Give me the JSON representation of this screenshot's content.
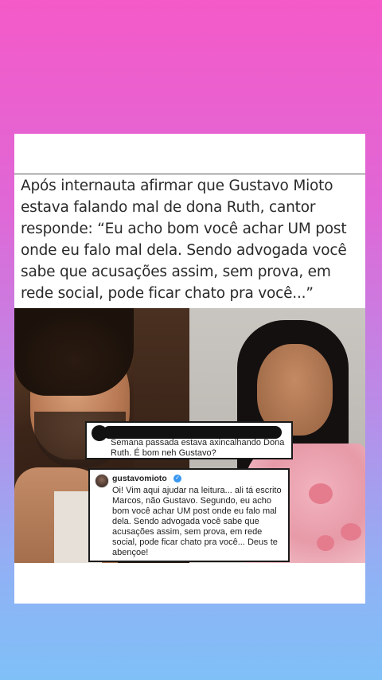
{
  "post": {
    "headline": "Após internauta afirmar que Gustavo Mioto estava falando mal de dona Ruth, cantor responde: “Eu acho bom você achar UM post onde eu falo mal dela. Sendo advogada você sabe que acusações assim, sem prova, em rede social, pode ficar chato pra você...”"
  },
  "comments": [
    {
      "username": "",
      "text": "Semana passada estava axincalhando Dona Ruth. É bom neh Gustavo?"
    },
    {
      "username": "gustavomioto",
      "verified": true,
      "text": "Oi! Vim aqui ajudar na leitura... ali tá escrito Marcos, não Gustavo. Segundo, eu acho bom você achar UM post onde eu falo mal dela. Sendo advogada você sabe que acusações assim, sem prova, em rede social, pode ficar chato pra você... Deus te abençoe!"
    }
  ],
  "icons": {
    "verified": "verified-badge-icon"
  },
  "colors": {
    "verified_blue": "#3897f0",
    "background_top": "#f45ac8",
    "background_bottom": "#7fc0f7"
  }
}
